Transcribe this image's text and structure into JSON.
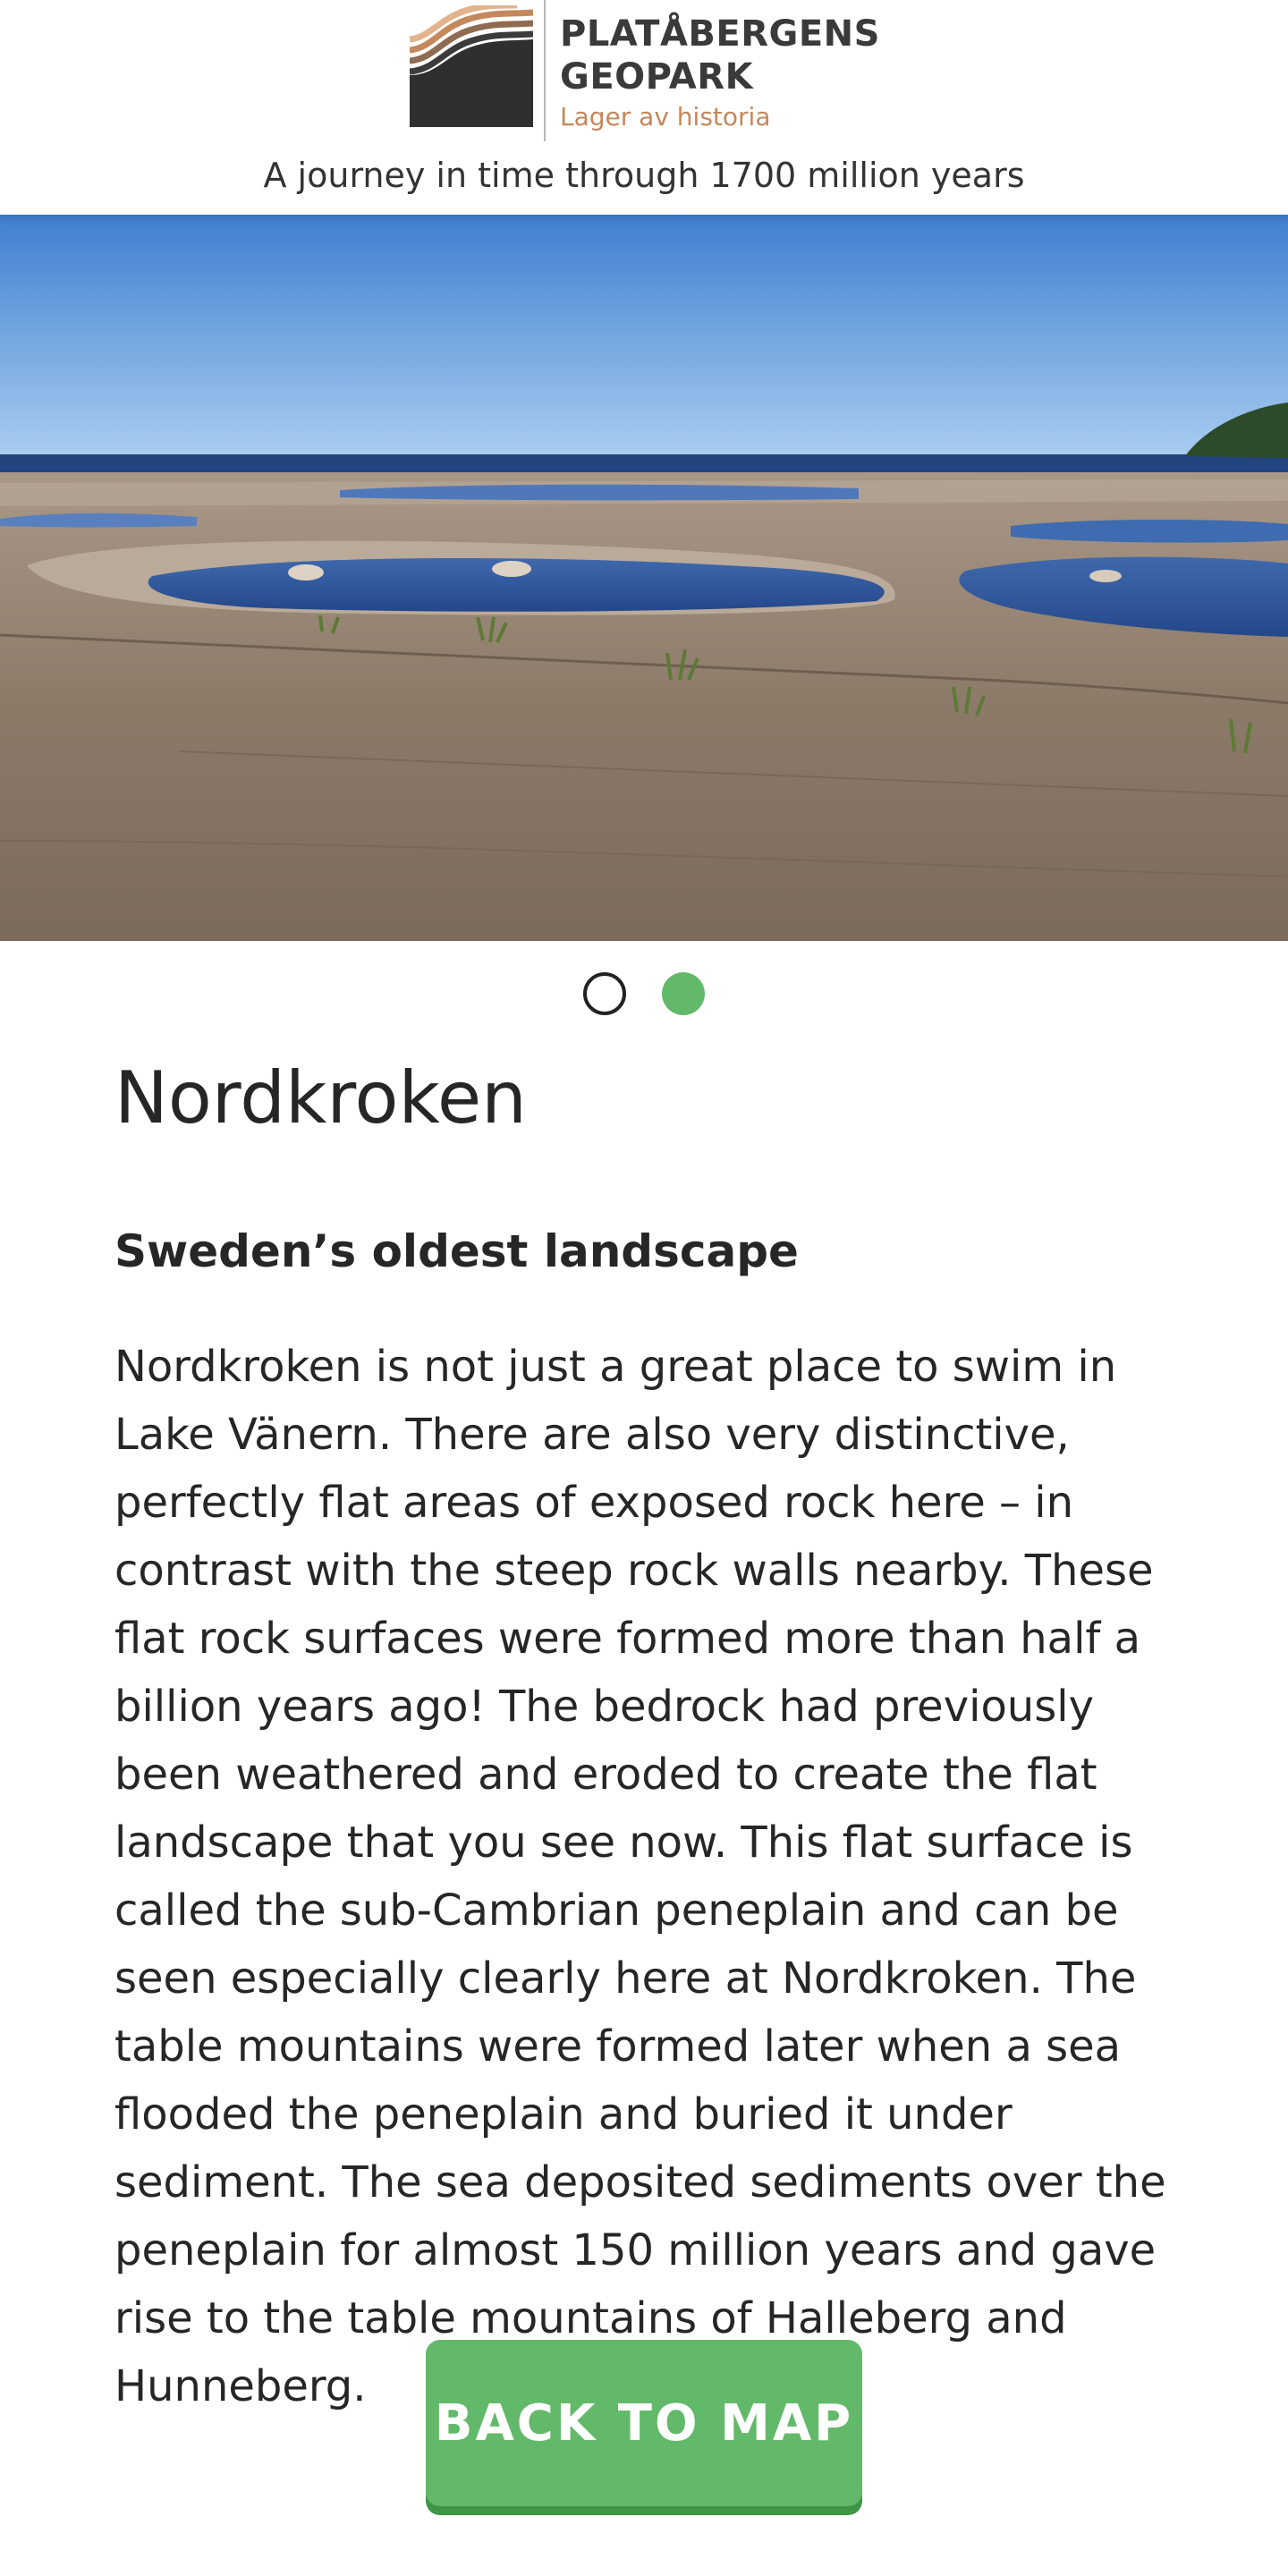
{
  "header": {
    "logo": {
      "name_line1": "PLATÅBERGENS",
      "name_line2": "GEOPARK",
      "tagline": "Lager av historia",
      "mark_icon": "layered-strata-logo-icon"
    },
    "subtitle": "A journey in time through 1700 million years"
  },
  "carousel": {
    "slide_count": 2,
    "active_index": 1,
    "image_description_icon": "flat-rock-shoreline-photo"
  },
  "article": {
    "title": "Nordkroken",
    "heading": "Sweden’s oldest landscape",
    "body": "Nordkroken is not just a great place to swim in Lake Vänern. There are also very distinctive, perfectly flat areas of exposed rock here – in contrast with the steep rock walls nearby. These flat rock surfaces were formed more than half a billion years ago! The bedrock had previously been weathered and eroded to create the flat landscape that you see now. This flat surface is called the sub-Cambrian peneplain and can be seen especially clearly here at Nordkroken. The table mountains were formed later when a sea flooded the peneplain and buried it under sediment. The sea deposited sediments over the peneplain for almost 150 million years and gave rise to the table mountains of Halleberg and Hunneberg."
  },
  "actions": {
    "back_label": "BACK TO MAP"
  },
  "colors": {
    "accent_green": "#63b96a",
    "logo_tagline": "#c5875c",
    "text": "#262626"
  }
}
